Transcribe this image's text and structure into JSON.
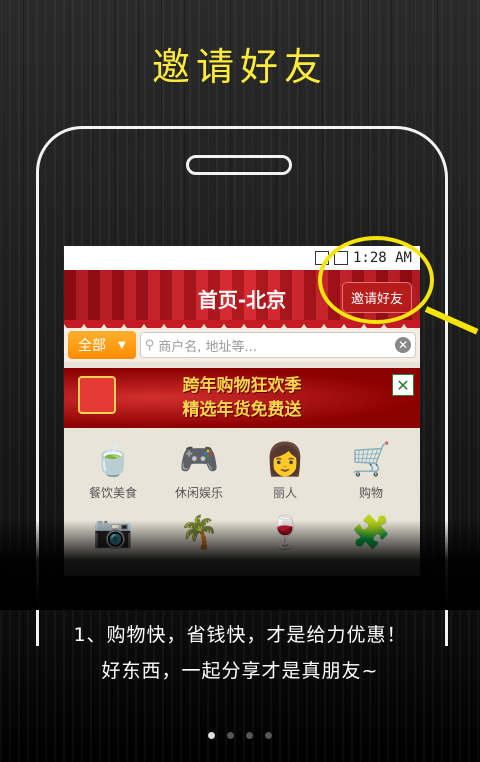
{
  "headline": "邀请好友",
  "app": {
    "status_time": "1:28 AM",
    "header_title": "首页-北京",
    "invite_button": "邀请好友",
    "search": {
      "category": "全部",
      "placeholder": "商户名, 地址等..."
    },
    "banner": {
      "line1": "跨年购物狂欢季",
      "line2": "精选年货免费送"
    },
    "categories": [
      {
        "label": "餐饮美食",
        "icon": "food-icon",
        "glyph": "🍵"
      },
      {
        "label": "休闲娱乐",
        "icon": "gamepad-icon",
        "glyph": "🎮"
      },
      {
        "label": "丽人",
        "icon": "woman-icon",
        "glyph": "👩"
      },
      {
        "label": "购物",
        "icon": "shopping-cart-icon",
        "glyph": "🛒"
      },
      {
        "label": "",
        "icon": "camera-icon",
        "glyph": "📷"
      },
      {
        "label": "",
        "icon": "palm-tree-icon",
        "glyph": "🌴"
      },
      {
        "label": "",
        "icon": "wine-glass-icon",
        "glyph": "🍷"
      },
      {
        "label": "",
        "icon": "puzzle-icon",
        "glyph": "🧩"
      }
    ]
  },
  "caption": {
    "line1": "1、购物快，省钱快，才是给力优惠！",
    "line2": "好东西，一起分享才是真朋友~"
  },
  "pager": {
    "total": 4,
    "active": 0
  },
  "colors": {
    "accent": "#f4e40a",
    "header_red": "#c41a21",
    "icon_gold": "#b37c22"
  }
}
